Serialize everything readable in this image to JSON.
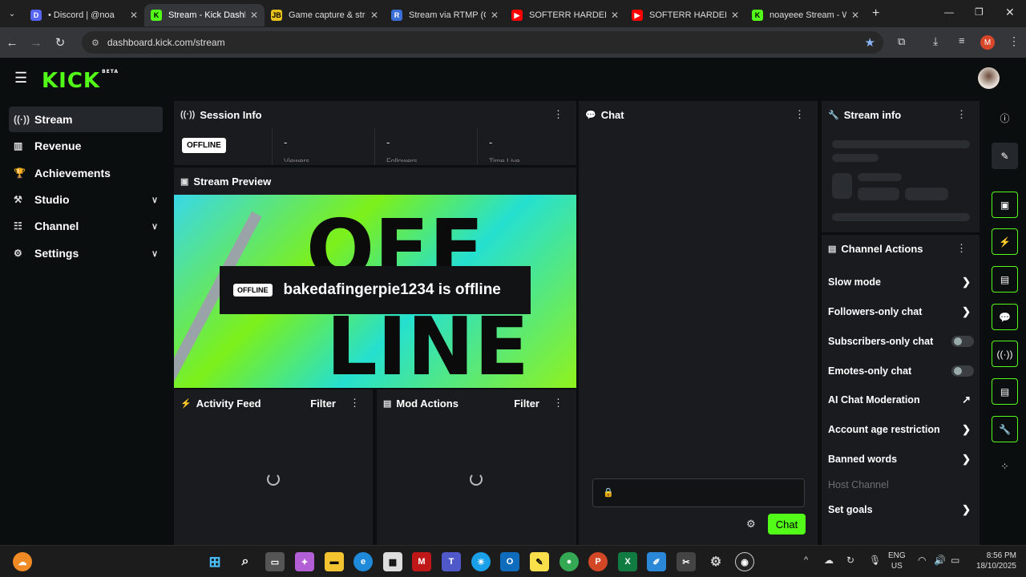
{
  "browser": {
    "tabs": [
      {
        "title": "• Discord | @noa",
        "favicon_color": "#5865f2",
        "favicon_glyph": "D"
      },
      {
        "title": "Stream - Kick Dashb",
        "favicon_color": "#53fc18",
        "favicon_glyph": "K"
      },
      {
        "title": "Game capture & stre",
        "favicon_color": "#e8c21c",
        "favicon_glyph": "JB"
      },
      {
        "title": "Stream via RTMP (OB",
        "favicon_color": "#3b6fd8",
        "favicon_glyph": "R"
      },
      {
        "title": "SOFTERR HARDERR",
        "favicon_color": "#ff0000",
        "favicon_glyph": "▶"
      },
      {
        "title": "SOFTERR HARDERR",
        "favicon_color": "#ff0000",
        "favicon_glyph": "▶"
      },
      {
        "title": "noayeee Stream - W",
        "favicon_color": "#53fc18",
        "favicon_glyph": "K"
      }
    ],
    "url": "dashboard.kick.com/stream",
    "profile_initial": "M"
  },
  "logo": {
    "text": "KICK",
    "beta": "BETA"
  },
  "sidebar": {
    "items": [
      {
        "label": "Stream",
        "icon": "broadcast-icon"
      },
      {
        "label": "Revenue",
        "icon": "chart-icon"
      },
      {
        "label": "Achievements",
        "icon": "trophy-icon"
      },
      {
        "label": "Studio",
        "icon": "studio-icon"
      },
      {
        "label": "Channel",
        "icon": "channel-icon"
      },
      {
        "label": "Settings",
        "icon": "gear-icon"
      }
    ]
  },
  "session": {
    "title": "Session Info",
    "status": "OFFLINE",
    "stats": [
      {
        "value": "-",
        "label": "Viewers"
      },
      {
        "value": "-",
        "label": "Followers"
      },
      {
        "value": "-",
        "label": "Time Live"
      }
    ]
  },
  "preview": {
    "title": "Stream Preview",
    "badge": "OFFLINE",
    "message": "bakedafingerpie1234 is offline",
    "bg_top": "OFF",
    "bg_bottom": "LINE"
  },
  "activity": {
    "title": "Activity Feed",
    "filter": "Filter"
  },
  "mod": {
    "title": "Mod Actions",
    "filter": "Filter"
  },
  "chat": {
    "title": "Chat",
    "send": "Chat"
  },
  "stream_info": {
    "title": "Stream info"
  },
  "channel_actions": {
    "title": "Channel Actions",
    "rows": [
      {
        "label": "Slow mode",
        "kind": "arrow"
      },
      {
        "label": "Followers-only chat",
        "kind": "arrow"
      },
      {
        "label": "Subscribers-only chat",
        "kind": "toggle"
      },
      {
        "label": "Emotes-only chat",
        "kind": "toggle"
      },
      {
        "label": "AI Chat Moderation",
        "kind": "external"
      },
      {
        "label": "Account age restriction",
        "kind": "arrow"
      },
      {
        "label": "Banned words",
        "kind": "arrow"
      },
      {
        "label": "Host Channel",
        "kind": "disabled"
      },
      {
        "label": "Set goals",
        "kind": "arrow"
      }
    ]
  },
  "taskbar": {
    "lang": "ENG",
    "region": "US",
    "time": "8:56 PM",
    "date": "18/10/2025"
  },
  "colors": {
    "accent": "#53fc18",
    "panel": "#191b1f",
    "bg": "#0b0e0f"
  }
}
